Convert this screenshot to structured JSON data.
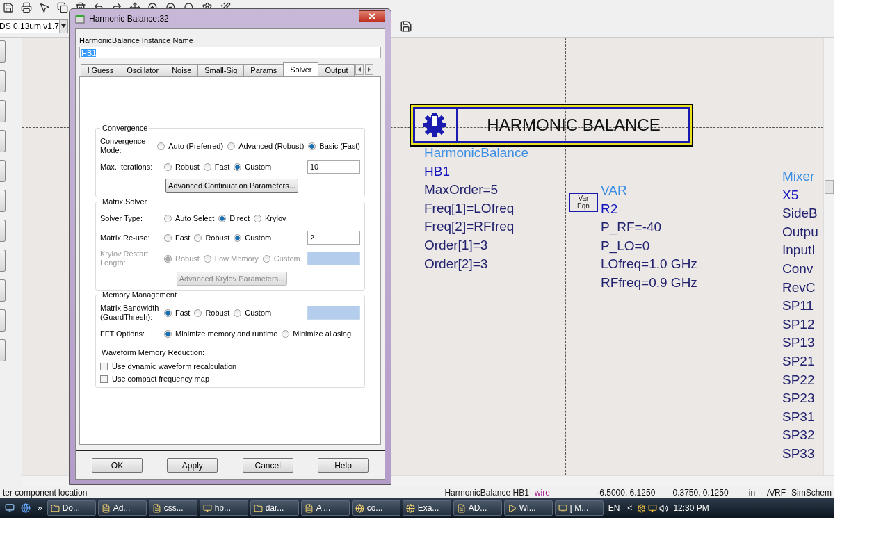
{
  "toolbar": {
    "process_combo": "DS 0.13um v1.7"
  },
  "schematic": {
    "hb_title": "HARMONIC BALANCE",
    "hb_params": [
      {
        "text": "HarmonicBalance",
        "kind": "type"
      },
      {
        "text": "HB1",
        "kind": "name"
      },
      {
        "text": "MaxOrder=5",
        "kind": "param"
      },
      {
        "text": "Freq[1]=LOfreq",
        "kind": "param"
      },
      {
        "text": "Freq[2]=RFfreq",
        "kind": "param"
      },
      {
        "text": "Order[1]=3",
        "kind": "param"
      },
      {
        "text": "Order[2]=3",
        "kind": "param"
      }
    ],
    "var_symbol": [
      "Var",
      "Eqn"
    ],
    "var_params": [
      {
        "text": "VAR",
        "kind": "type"
      },
      {
        "text": "R2",
        "kind": "name"
      },
      {
        "text": "P_RF=-40",
        "kind": "param"
      },
      {
        "text": "P_LO=0",
        "kind": "param"
      },
      {
        "text": "LOfreq=1.0 GHz",
        "kind": "param"
      },
      {
        "text": "RFfreq=0.9 GHz",
        "kind": "param"
      }
    ],
    "mixer_params": [
      {
        "text": "Mixer",
        "kind": "type"
      },
      {
        "text": "X5",
        "kind": "name"
      },
      {
        "text": "SideB",
        "kind": "param"
      },
      {
        "text": "Outpu",
        "kind": "param"
      },
      {
        "text": "InputI",
        "kind": "param"
      },
      {
        "text": "Conv",
        "kind": "param"
      },
      {
        "text": "RevC",
        "kind": "param"
      },
      {
        "text": "SP11",
        "kind": "param"
      },
      {
        "text": "SP12",
        "kind": "param"
      },
      {
        "text": "SP13",
        "kind": "param"
      },
      {
        "text": "SP21",
        "kind": "param"
      },
      {
        "text": "SP22",
        "kind": "param"
      },
      {
        "text": "SP23",
        "kind": "param"
      },
      {
        "text": "SP31",
        "kind": "param"
      },
      {
        "text": "SP32",
        "kind": "param"
      },
      {
        "text": "SP33",
        "kind": "param"
      }
    ]
  },
  "status_bar": {
    "prompt": "ter component location",
    "selection": "HarmonicBalance HB1",
    "layer": "wire",
    "coords": "-6.5000, 6.1250",
    "delta": "0.3750, 0.1250",
    "units": "in",
    "mode": "A/RF",
    "app": "SimSchem"
  },
  "taskbar": {
    "more": "»",
    "items": [
      "Do...",
      "Ad...",
      "css...",
      "hp...",
      "dar...",
      "A ...",
      "co...",
      "Exa...",
      "AD...",
      "Wi...",
      "[ M..."
    ],
    "language": "EN",
    "tray_toggle": "<",
    "clock": "12:30 PM"
  },
  "dialog": {
    "title": "Harmonic Balance:32",
    "instance_label": "HarmonicBalance Instance Name",
    "instance_value": "HB1",
    "tabs": [
      {
        "label": "l Guess",
        "selected": false
      },
      {
        "label": "Oscillator",
        "selected": false
      },
      {
        "label": "Noise",
        "selected": false
      },
      {
        "label": "Small-Sig",
        "selected": false
      },
      {
        "label": "Params",
        "selected": false
      },
      {
        "label": "Solver",
        "selected": true
      },
      {
        "label": "Output",
        "selected": false
      }
    ],
    "groups": [
      {
        "title": "Convergence",
        "rows": [
          {
            "kind": "radio",
            "label": "Convergence Mode:",
            "disabled": false,
            "options": [
              {
                "label": "Auto (Preferred)",
                "selected": false
              },
              {
                "label": "Advanced (Robust)",
                "selected": false
              },
              {
                "label": "Basic (Fast)",
                "selected": true
              }
            ]
          },
          {
            "kind": "radio",
            "label": "Max. Iterations:",
            "disabled": false,
            "options": [
              {
                "label": "Robust",
                "selected": false
              },
              {
                "label": "Fast",
                "selected": false
              },
              {
                "label": "Custom",
                "selected": true
              }
            ],
            "field": {
              "value": "10",
              "disabled": false
            }
          },
          {
            "kind": "button",
            "label": "Advanced Continuation Parameters...",
            "disabled": false
          }
        ]
      },
      {
        "title": "Matrix Solver",
        "rows": [
          {
            "kind": "radio",
            "label": "Solver Type:",
            "disabled": false,
            "options": [
              {
                "label": "Auto Select",
                "selected": false
              },
              {
                "label": "Direct",
                "selected": true
              },
              {
                "label": "Krylov",
                "selected": false
              }
            ]
          },
          {
            "kind": "radio",
            "label": "Matrix Re-use:",
            "disabled": false,
            "options": [
              {
                "label": "Fast",
                "selected": false
              },
              {
                "label": "Robust",
                "selected": false
              },
              {
                "label": "Custom",
                "selected": true
              }
            ],
            "field": {
              "value": "2",
              "disabled": false
            }
          },
          {
            "kind": "radio",
            "label": "Krylov Restart Length:",
            "disabled": true,
            "options": [
              {
                "label": "Robust",
                "selected": true
              },
              {
                "label": "Low Memory",
                "selected": false
              },
              {
                "label": "Custom",
                "selected": false
              }
            ],
            "field": {
              "disabled": true
            }
          },
          {
            "kind": "button",
            "label": "Advanced Krylov Parameters...",
            "disabled": true
          }
        ]
      },
      {
        "title": "Memory Management",
        "rows": [
          {
            "kind": "radio",
            "label": "Matrix Bandwidth (GuardThresh):",
            "disabled": false,
            "options": [
              {
                "label": "Fast",
                "selected": true
              },
              {
                "label": "Robust",
                "selected": false
              },
              {
                "label": "Custom",
                "selected": false
              }
            ],
            "field": {
              "disabled": true
            }
          },
          {
            "kind": "radio",
            "label": "FFT Options:",
            "disabled": false,
            "options": [
              {
                "label": "Minimize memory and runtime",
                "selected": true
              },
              {
                "label": "Minimize aliasing",
                "selected": false
              }
            ]
          },
          {
            "kind": "heading",
            "label": "Waveform Memory Reduction:"
          },
          {
            "kind": "checkbox",
            "label": "Use dynamic waveform recalculation",
            "checked": false
          },
          {
            "kind": "checkbox",
            "label": "Use compact frequency map",
            "checked": false
          }
        ]
      }
    ],
    "buttons": [
      "OK",
      "Apply",
      "Cancel",
      "Help"
    ]
  }
}
